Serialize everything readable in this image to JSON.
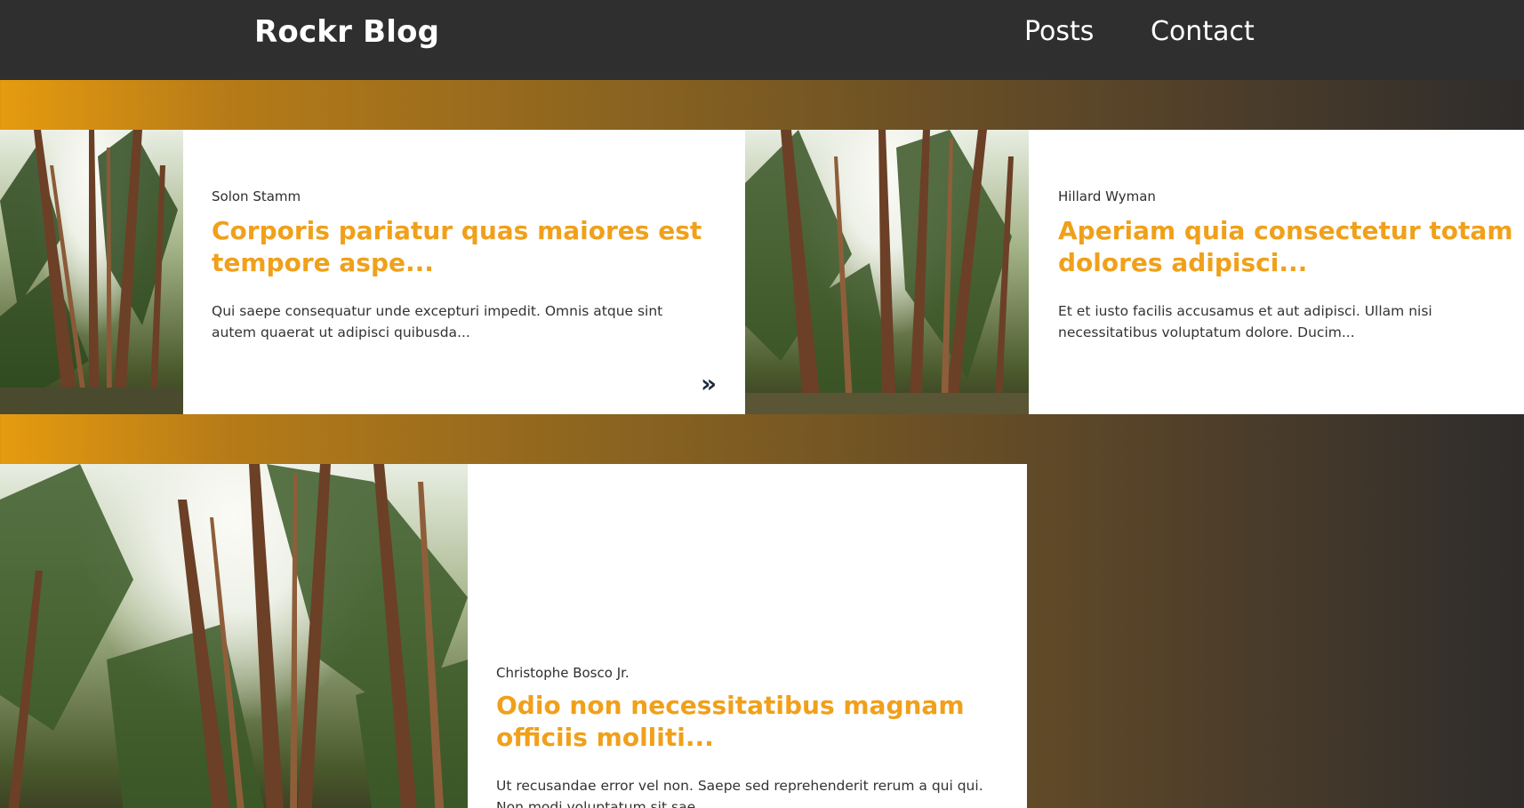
{
  "header": {
    "brand": "Rockr Blog",
    "nav": [
      {
        "label": "Posts"
      },
      {
        "label": "Contact"
      }
    ]
  },
  "posts": [
    {
      "author": "Solon Stamm",
      "title": "Corporis pariatur quas maiores est tempore aspe...",
      "excerpt": "Qui saepe consequatur unde excepturi impedit. Omnis atque sint autem quaerat ut adipisci quibusda...",
      "more_icon": "double-chevron-right-icon"
    },
    {
      "author": "Hillard Wyman",
      "title": "Aperiam quia consectetur totam dolores adipisci...",
      "excerpt": "Et et iusto facilis accusamus et aut adipisci. Ullam nisi necessitatibus voluptatum dolore. Ducim..."
    },
    {
      "author": "Christophe Bosco Jr.",
      "title": "Odio non necessitatibus magnam officiis molliti...",
      "excerpt": "Ut recusandae error vel non. Saepe sed reprehenderit rerum a qui qui. Non modi voluptatum sit sae..."
    }
  ],
  "colors": {
    "header_bg": "#2f2f2f",
    "accent": "#f0a01a",
    "gradient_start": "#e69b0f",
    "gradient_end": "#2e2c2b"
  }
}
